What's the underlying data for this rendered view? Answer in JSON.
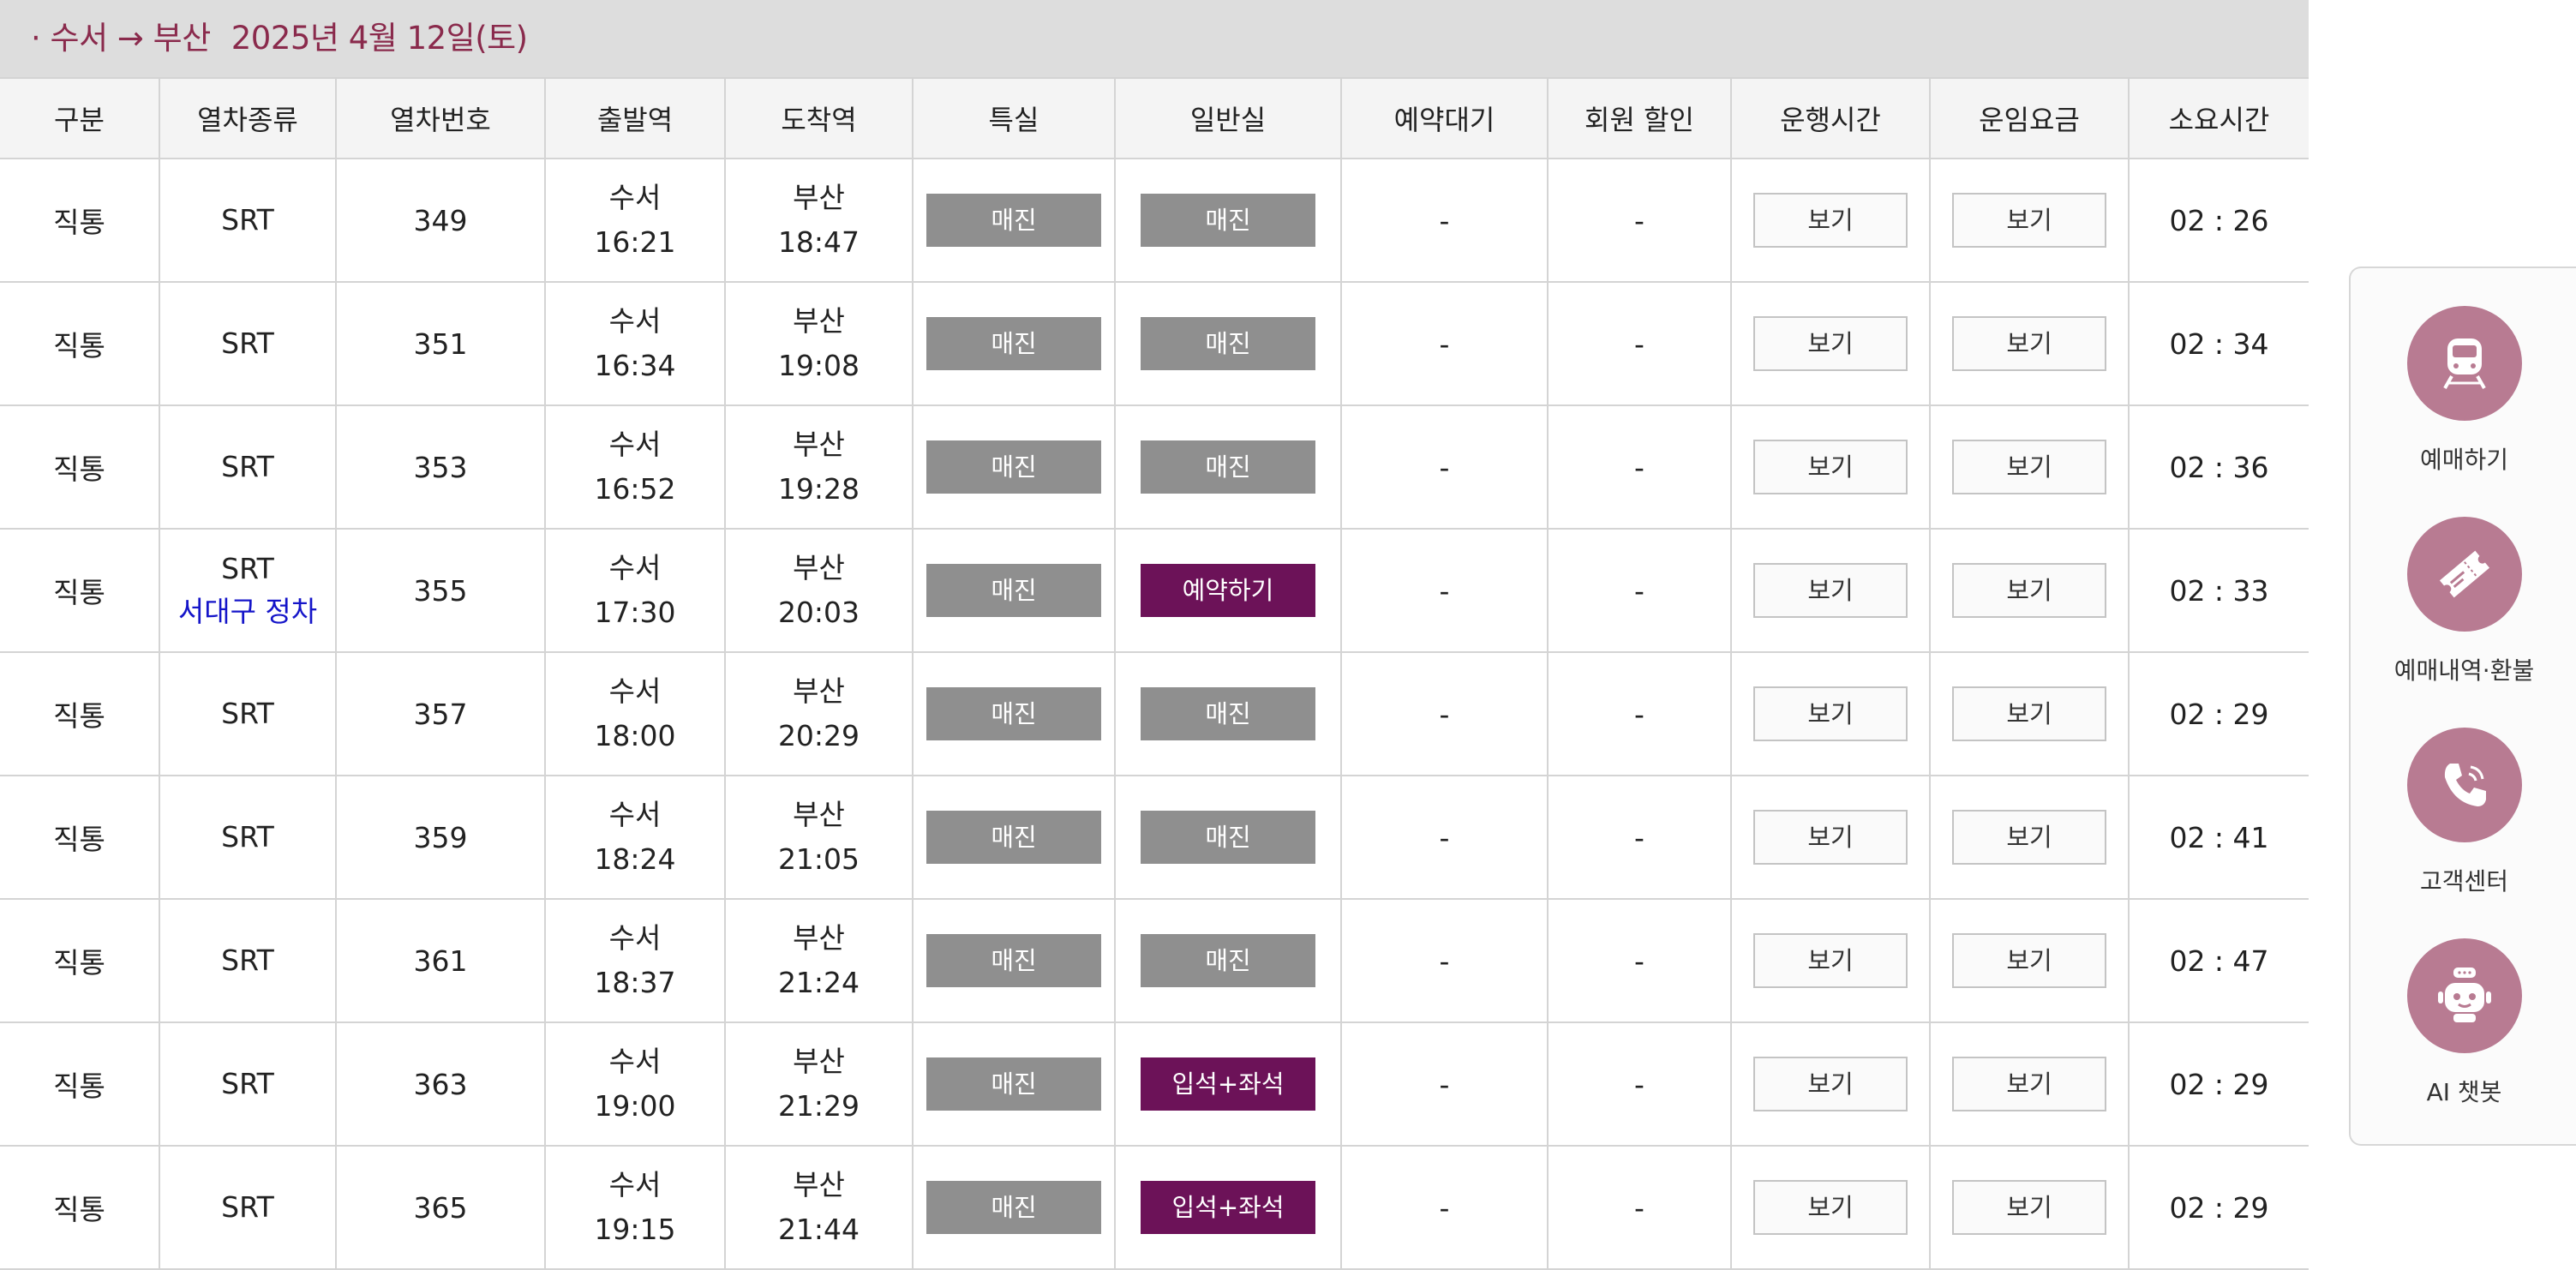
{
  "route": {
    "bullet": "·",
    "from": "수서",
    "arrow": "→",
    "to": "부산",
    "date": "2025년 4월 12일(토)"
  },
  "headers": [
    "구분",
    "열차종류",
    "열차번호",
    "출발역",
    "도착역",
    "특실",
    "일반실",
    "예약대기",
    "회원 할인",
    "운행시간",
    "운임요금",
    "소요시간"
  ],
  "rows": [
    {
      "category": "직통",
      "train_type": "SRT",
      "note": "",
      "train_no": "349",
      "dep_station": "수서",
      "dep_time": "16:21",
      "arr_station": "부산",
      "arr_time": "18:47",
      "first_class": "매진",
      "general": "매진",
      "general_available": false,
      "waitlist": "-",
      "discount": "-",
      "schedule": "보기",
      "fare": "보기",
      "duration": "02 : 26"
    },
    {
      "category": "직통",
      "train_type": "SRT",
      "note": "",
      "train_no": "351",
      "dep_station": "수서",
      "dep_time": "16:34",
      "arr_station": "부산",
      "arr_time": "19:08",
      "first_class": "매진",
      "general": "매진",
      "general_available": false,
      "waitlist": "-",
      "discount": "-",
      "schedule": "보기",
      "fare": "보기",
      "duration": "02 : 34"
    },
    {
      "category": "직통",
      "train_type": "SRT",
      "note": "",
      "train_no": "353",
      "dep_station": "수서",
      "dep_time": "16:52",
      "arr_station": "부산",
      "arr_time": "19:28",
      "first_class": "매진",
      "general": "매진",
      "general_available": false,
      "waitlist": "-",
      "discount": "-",
      "schedule": "보기",
      "fare": "보기",
      "duration": "02 : 36"
    },
    {
      "category": "직통",
      "train_type": "SRT",
      "note": "서대구 정차",
      "train_no": "355",
      "dep_station": "수서",
      "dep_time": "17:30",
      "arr_station": "부산",
      "arr_time": "20:03",
      "first_class": "매진",
      "general": "예약하기",
      "general_available": true,
      "waitlist": "-",
      "discount": "-",
      "schedule": "보기",
      "fare": "보기",
      "duration": "02 : 33"
    },
    {
      "category": "직통",
      "train_type": "SRT",
      "note": "",
      "train_no": "357",
      "dep_station": "수서",
      "dep_time": "18:00",
      "arr_station": "부산",
      "arr_time": "20:29",
      "first_class": "매진",
      "general": "매진",
      "general_available": false,
      "waitlist": "-",
      "discount": "-",
      "schedule": "보기",
      "fare": "보기",
      "duration": "02 : 29"
    },
    {
      "category": "직통",
      "train_type": "SRT",
      "note": "",
      "train_no": "359",
      "dep_station": "수서",
      "dep_time": "18:24",
      "arr_station": "부산",
      "arr_time": "21:05",
      "first_class": "매진",
      "general": "매진",
      "general_available": false,
      "waitlist": "-",
      "discount": "-",
      "schedule": "보기",
      "fare": "보기",
      "duration": "02 : 41"
    },
    {
      "category": "직통",
      "train_type": "SRT",
      "note": "",
      "train_no": "361",
      "dep_station": "수서",
      "dep_time": "18:37",
      "arr_station": "부산",
      "arr_time": "21:24",
      "first_class": "매진",
      "general": "매진",
      "general_available": false,
      "waitlist": "-",
      "discount": "-",
      "schedule": "보기",
      "fare": "보기",
      "duration": "02 : 47"
    },
    {
      "category": "직통",
      "train_type": "SRT",
      "note": "",
      "train_no": "363",
      "dep_station": "수서",
      "dep_time": "19:00",
      "arr_station": "부산",
      "arr_time": "21:29",
      "first_class": "매진",
      "general": "입석+좌석",
      "general_available": true,
      "waitlist": "-",
      "discount": "-",
      "schedule": "보기",
      "fare": "보기",
      "duration": "02 : 29"
    },
    {
      "category": "직통",
      "train_type": "SRT",
      "note": "",
      "train_no": "365",
      "dep_station": "수서",
      "dep_time": "19:15",
      "arr_station": "부산",
      "arr_time": "21:44",
      "first_class": "매진",
      "general": "입석+좌석",
      "general_available": true,
      "waitlist": "-",
      "discount": "-",
      "schedule": "보기",
      "fare": "보기",
      "duration": "02 : 29"
    }
  ],
  "side_menu": [
    {
      "label": "예매하기",
      "icon": "train-icon"
    },
    {
      "label": "예매내역·환불",
      "icon": "ticket-icon"
    },
    {
      "label": "고객센터",
      "icon": "phone-icon"
    },
    {
      "label": "AI 챗봇",
      "icon": "robot-icon"
    }
  ],
  "colors": {
    "route_text": "#8a2a4c",
    "sold_out_button": "#8f8f8f",
    "available_button": "#6c1258",
    "stop_note": "#1515c9",
    "side_icon_circle": "#b87b92"
  }
}
